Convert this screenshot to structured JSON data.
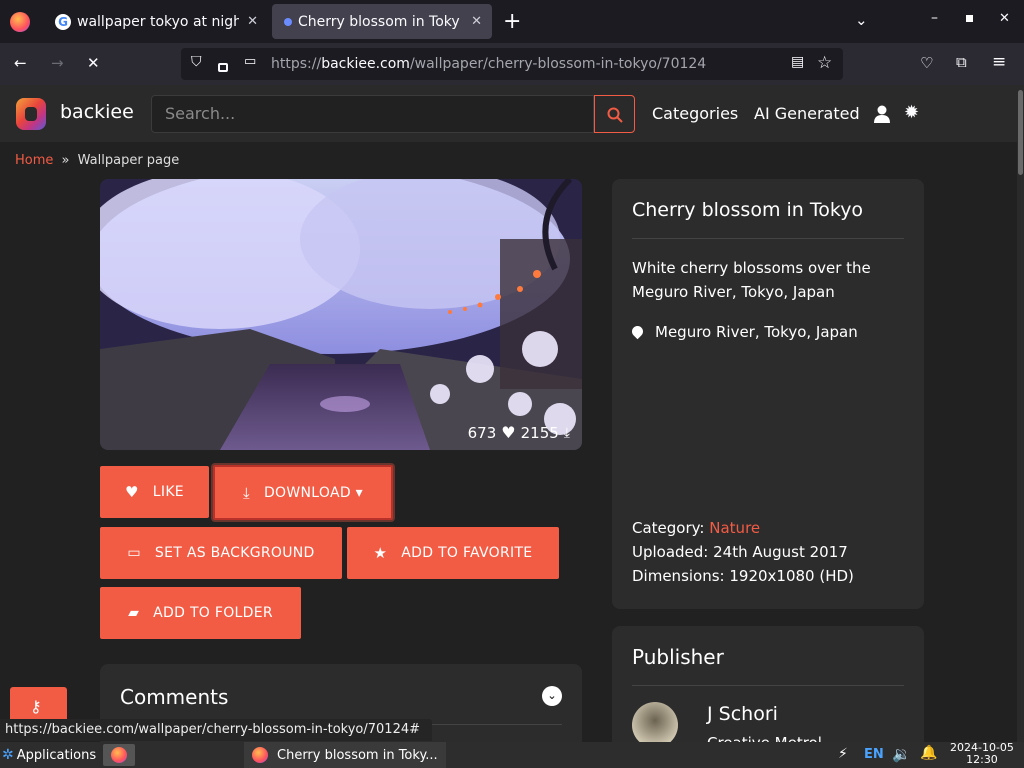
{
  "browser": {
    "tabs": [
      {
        "title": "wallpaper tokyo at night",
        "active": false
      },
      {
        "title": "Cherry blossom in Tokyo",
        "active": true
      }
    ],
    "url_prefix": "https://",
    "url_domain": "backiee.com",
    "url_path": "/wallpaper/cherry-blossom-in-tokyo/70124",
    "status_url": "https://backiee.com/wallpaper/cherry-blossom-in-tokyo/70124#"
  },
  "site": {
    "brand": "backiee",
    "search_placeholder": "Search...",
    "nav": [
      "Categories",
      "AI Generated"
    ]
  },
  "breadcrumb": {
    "home": "Home",
    "sep": "»",
    "current": "Wallpaper page"
  },
  "photo": {
    "likes": "673",
    "downloads": "2155"
  },
  "buttons": {
    "like": "LIKE",
    "download": "DOWNLOAD",
    "set_background": "SET AS BACKGROUND",
    "add_favorite": "ADD TO FAVORITE",
    "add_folder": "ADD TO FOLDER"
  },
  "comments": {
    "title": "Comments"
  },
  "info": {
    "title": "Cherry blossom in Tokyo",
    "description": "White cherry blossoms over the Meguro River, Tokyo, Japan",
    "location": "Meguro River, Tokyo, Japan",
    "category_label": "Category:",
    "category": "Nature",
    "uploaded": "Uploaded: 24th August 2017",
    "dimensions": "Dimensions: 1920x1080 (HD)"
  },
  "publisher": {
    "heading": "Publisher",
    "name": "J Schori",
    "subtitle": "Creative Metrol..."
  },
  "taskbar": {
    "applications": "Applications",
    "window": "Cherry blossom in Toky...",
    "lang": "EN",
    "date": "2024-10-05",
    "time": "12:30"
  },
  "colors": {
    "accent": "#f25b44",
    "page_bg": "#212121",
    "card_bg": "#2c2c2c"
  }
}
